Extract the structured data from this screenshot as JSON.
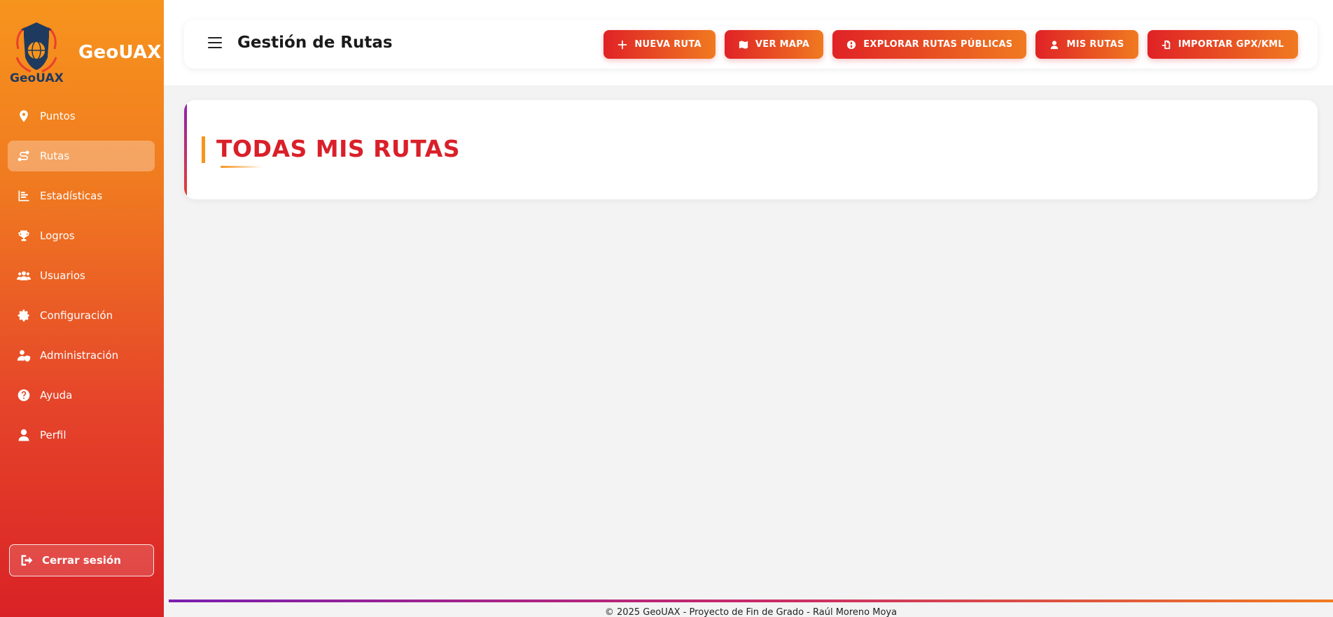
{
  "sidebar": {
    "logo_text": "GeoUAX",
    "brand": "GeoUAX",
    "items": [
      {
        "label": "Puntos",
        "icon": "map-pin-icon"
      },
      {
        "label": "Rutas",
        "icon": "route-icon"
      },
      {
        "label": "Estadísticas",
        "icon": "chart-icon"
      },
      {
        "label": "Logros",
        "icon": "trophy-icon"
      },
      {
        "label": "Usuarios",
        "icon": "users-icon"
      },
      {
        "label": "Configuración",
        "icon": "gear-icon"
      },
      {
        "label": "Administración",
        "icon": "user-shield-icon"
      },
      {
        "label": "Ayuda",
        "icon": "question-icon"
      },
      {
        "label": "Perfil",
        "icon": "user-icon"
      }
    ],
    "active_item": "Rutas",
    "logout_label": "Cerrar sesión"
  },
  "header": {
    "title": "Gestión de Rutas",
    "actions": [
      {
        "label": "NUEVA RUTA",
        "icon": "plus-icon"
      },
      {
        "label": "VER MAPA",
        "icon": "map-icon"
      },
      {
        "label": "EXPLORAR RUTAS PÚBLICAS",
        "icon": "globe-icon"
      },
      {
        "label": "MIS RUTAS",
        "icon": "user-icon"
      },
      {
        "label": "IMPORTAR GPX/KML",
        "icon": "file-import-icon"
      }
    ]
  },
  "main": {
    "section_title": "TODAS MIS RUTAS"
  },
  "footer": {
    "text": "© 2025 GeoUAX - Proyecto de Fin de Grado - Raúl Moreno Moya"
  },
  "colors": {
    "primary_red": "#d9202a",
    "primary_orange": "#f7941d",
    "accent_purple": "#7a1fb0"
  }
}
